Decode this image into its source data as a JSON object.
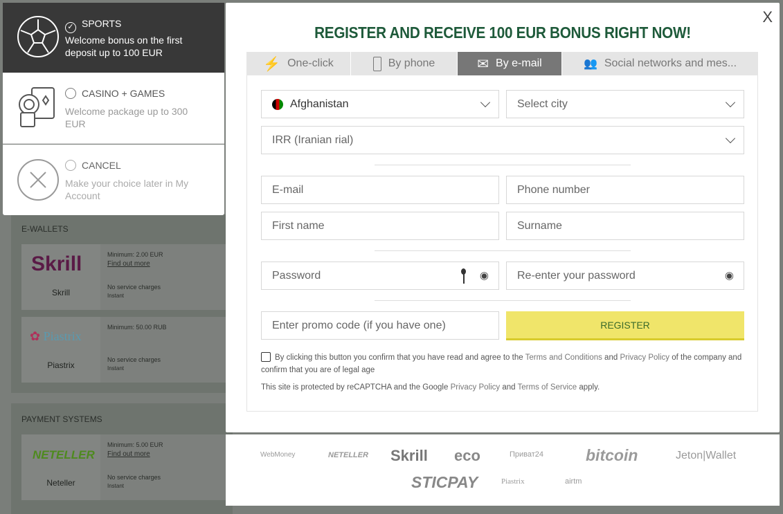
{
  "background": {
    "ewallets": {
      "title": "E-WALLETS",
      "items": [
        {
          "logo": "Skrill",
          "name": "Skrill",
          "minimum": "Minimum: 2.00 EUR",
          "find_more": "Find out more",
          "fee": "No service charges",
          "speed": "Instant"
        },
        {
          "logo": "Piastrix",
          "name": "Piastrix",
          "minimum": "Minimum: 50.00 RUB",
          "fee": "No service charges",
          "speed": "Instant"
        }
      ]
    },
    "payment_systems": {
      "title": "PAYMENT SYSTEMS",
      "items": [
        {
          "logo": "NETELLER",
          "name": "Neteller",
          "minimum": "Minimum: 5.00 EUR",
          "find_more": "Find out more",
          "fee": "No service charges",
          "speed": "Instant"
        }
      ]
    }
  },
  "bonus": {
    "options": [
      {
        "title": "SPORTS",
        "desc": "Welcome bonus on the first deposit up to 100 EUR",
        "selected": true,
        "icon": "soccer-ball-icon"
      },
      {
        "title": "CASINO + GAMES",
        "desc": "Welcome package up to 300 EUR",
        "selected": false,
        "icon": "casino-chips-cards-icon"
      },
      {
        "title": "CANCEL",
        "desc": "Make your choice later in My Account",
        "selected": false,
        "icon": "cancel-circle-icon"
      }
    ]
  },
  "modal": {
    "title": "REGISTER AND RECEIVE 100 EUR BONUS RIGHT NOW!",
    "close": "X",
    "tabs": [
      {
        "label": "One-click",
        "icon": "lightning-icon"
      },
      {
        "label": "By phone",
        "icon": "phone-icon"
      },
      {
        "label": "By e-mail",
        "icon": "envelope-icon",
        "active": true
      },
      {
        "label": "Social networks and mes...",
        "icon": "users-icon"
      }
    ],
    "form": {
      "country": "Afghanistan",
      "city_placeholder": "Select city",
      "currency": "IRR (Iranian rial)",
      "email_placeholder": "E-mail",
      "phone_placeholder": "Phone number",
      "first_name_placeholder": "First name",
      "surname_placeholder": "Surname",
      "password_placeholder": "Password",
      "repassword_placeholder": "Re-enter your password",
      "promo_placeholder": "Enter promo code (if you have one)",
      "register_label": "REGISTER",
      "agree_pre": "By clicking this button you confirm that you have read and agree to the ",
      "agree_terms": "Terms and Conditions",
      "agree_and": " and ",
      "agree_privacy": "Privacy Policy",
      "agree_post": " of the company and confirm that you are of legal age",
      "recaptcha_pre": "This site is protected by reCAPTCHA and the Google ",
      "recaptcha_privacy": "Privacy Policy",
      "recaptcha_and": " and ",
      "recaptcha_tos": "Terms of Service",
      "recaptcha_post": " apply."
    }
  },
  "payment_logos": [
    "WebMoney",
    "NETELLER",
    "Skrill",
    "eco",
    "Приват24",
    "bitcoin",
    "Jeton|Wallet",
    "STICPAY",
    "Piastrix",
    "airtm"
  ],
  "colors": {
    "title_green": "#1e5a3a",
    "register_yellow": "#f0e56a",
    "active_tab": "#777777"
  }
}
